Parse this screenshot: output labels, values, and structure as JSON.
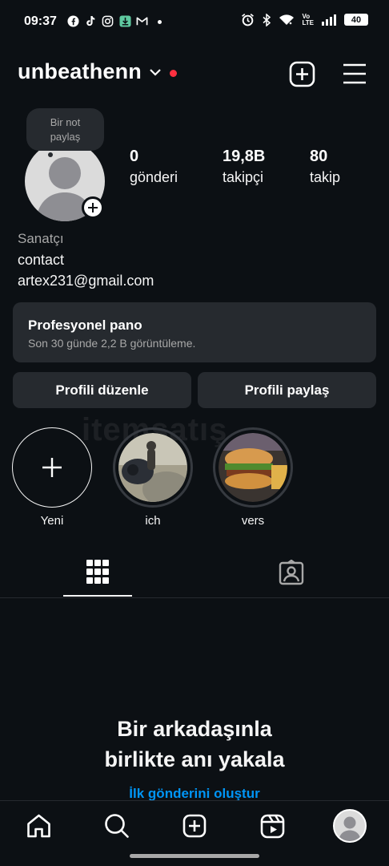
{
  "status_bar": {
    "time": "09:37",
    "battery": "40",
    "left_icons": [
      "facebook-icon",
      "tiktok-icon",
      "instagram-icon",
      "download-icon",
      "gmail-icon",
      "dot-icon"
    ],
    "right_icons": [
      "alarm-icon",
      "bluetooth-icon",
      "wifi-icon",
      "volte-icon",
      "signal-icon",
      "battery-icon"
    ],
    "volte_top": "Vo",
    "volte_bottom": "LTE"
  },
  "header": {
    "username": "unbeathenn",
    "live_dot_color": "#ff3040"
  },
  "note": {
    "line1": "Bir not",
    "line2": "paylaş"
  },
  "stats": {
    "posts_value": "0",
    "posts_label": "gönderi",
    "followers_value": "19,8B",
    "followers_label": "takipçi",
    "following_value": "80",
    "following_label": "takip"
  },
  "bio": {
    "category": "Sanatçı",
    "line1": "contact",
    "line2": "artex231@gmail.com"
  },
  "pro_dashboard": {
    "title": "Profesyonel pano",
    "subtitle": "Son 30 günde 2,2 B görüntüleme."
  },
  "buttons": {
    "edit_profile": "Profili düzenle",
    "share_profile": "Profili paylaş"
  },
  "watermark": "itemsatış",
  "highlights": [
    {
      "label": "Yeni"
    },
    {
      "label": "ich"
    },
    {
      "label": "vers"
    }
  ],
  "empty_state": {
    "title_line1": "Bir arkadaşınla",
    "title_line2": "birlikte anı yakala",
    "link": "İlk gönderini oluştur"
  },
  "colors": {
    "background": "#0c1014",
    "card": "#262a2f",
    "link": "#0095f6",
    "muted_text": "#a8a8a8"
  }
}
